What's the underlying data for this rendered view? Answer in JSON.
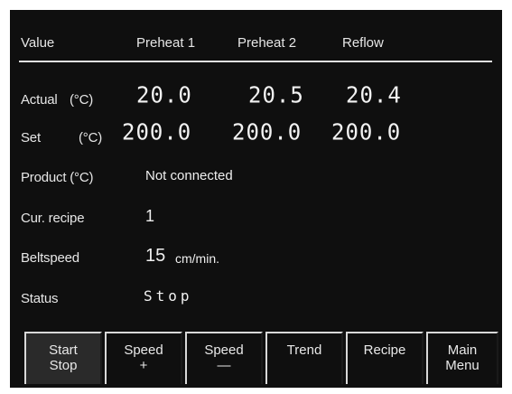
{
  "headers": {
    "value": "Value",
    "zone1": "Preheat 1",
    "zone2": "Preheat 2",
    "zone3": "Reflow"
  },
  "rows": {
    "actual": {
      "label": "Actual",
      "unit": "(°C)",
      "values": [
        "20.0",
        "20.5",
        "20.4"
      ]
    },
    "set": {
      "label": "Set",
      "unit": "(°C)",
      "values": [
        "200.0",
        "200.0",
        "200.0"
      ]
    }
  },
  "product": {
    "label": "Product (°C)",
    "value": "Not connected"
  },
  "recipe": {
    "label": "Cur. recipe",
    "value": "1"
  },
  "beltspeed": {
    "label": "Beltspeed",
    "value": "15",
    "unit": "cm/min."
  },
  "status": {
    "label": "Status",
    "value": "Stop"
  },
  "buttons": [
    {
      "line1": "Start",
      "line2": "Stop"
    },
    {
      "line1": "Speed",
      "line2": "+"
    },
    {
      "line1": "Speed",
      "line2": "—"
    },
    {
      "line1": "Trend",
      "line2": ""
    },
    {
      "line1": "Recipe",
      "line2": ""
    },
    {
      "line1": "Main",
      "line2": "Menu"
    }
  ]
}
